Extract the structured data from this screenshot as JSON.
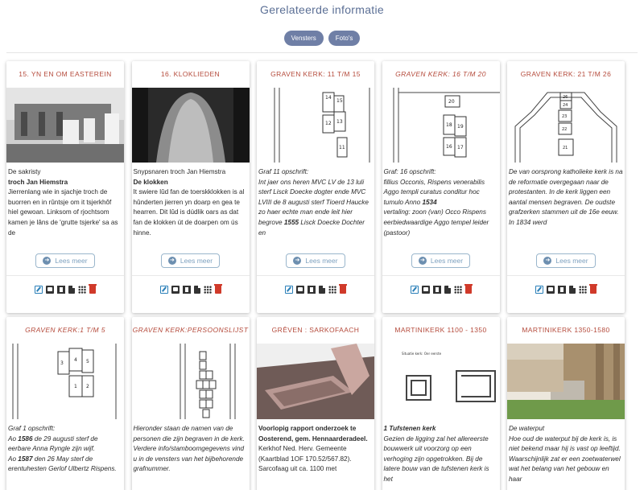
{
  "page": {
    "title": "Gerelateerde informatie",
    "filters": [
      "Vensters",
      "Foto's"
    ]
  },
  "common": {
    "read_more": "Lees meer"
  },
  "cards": [
    {
      "title": "15. YN EN OM EASTEREIN",
      "image_alt": "",
      "text_html": "De sakristy<br><b>troch Jan Hiemstra</b><br>Jierrenlang wie in sjachje troch de buorren en in rûntsje om it tsjerkhôf hiel gewoan. Linksom of rjochtsom kamen je lâns de 'grutte tsjerke' sa as de"
    },
    {
      "title": "16. KLOKLIEDEN",
      "image_alt": "",
      "text_html": "Snypsnaren troch Jan Hiemstra<br><b>De klokken</b><br>It swiere lûd fan de toerskklokken is al hûnderten jierren yn doarp en gea te hearren. Dit lûd is dúdlik oars as dat fan de klokken út de doarpen om ús hinne."
    },
    {
      "title": "GRAVEN KERK: 11 T/M 15",
      "image_alt": "",
      "text_html": "Graf 11 opschrift:<br>Int jaer ons heren MVC LV de 13 luli sterf Lisck Doecke dogter ende MVC LVIII de 8 augusti sterf Tioerd Haucke zo haer echte man ende leit hier begrove <b>1555</b> Lisck Doecke Dochter en"
    },
    {
      "title": "GRAVEN KERK: 16 T/M 20",
      "image_alt": "",
      "text_html": "Graf: 16 opschrift:<br>fillius Occonis, Rispens venerabilis Aggo templi curatus conditur hoc tumulo Anno <b>1534</b><br>vertaling: zoon (van) Occo Rispens eerbiedwaardige Aggo tempel leider (pastoor)"
    },
    {
      "title": "GRAVEN KERK: 21 T/M 26",
      "image_alt": "",
      "text_html": "De van oorsprong katholieke kerk is na de reformatie overgegaan naar de protestanten. In de kerk liggen een aantal mensen begraven. De oudste grafzerken stammen uit de 16e eeuw. In 1834 werd"
    },
    {
      "title": "GRAVEN KERK:1 T/M 5",
      "image_alt": "",
      "text_html": "Graf 1 opschrift:<br>Ao <b>1586</b> de 29 augusti sterf de eerbare Anna Ryngle zijn wijf.<br>Ao <b>1587</b> den 26 May sterf de erentuhesten Gerlof Ulbertz Rispens."
    },
    {
      "title": "GRAVEN KERK:PERSOONSLIJST",
      "image_alt": "",
      "text_html": "Hieronder staan de namen van de personen die zijn begraven in de kerk. Verdere info/stamboomgegevens vind u in de vensters van het bijbehorende grafnummer."
    },
    {
      "title": "GRÊVEN : SARKOFAACH",
      "image_alt": "",
      "text_html": "<b>Voorlopig rapport onderzoek te Oosterend, gem. Hennaarderadeel.</b><br>Kerkhof Ned. Herv. Gemeente (Kaartblad 1OF 170.52/567.82). Sarcofaag uit ca. 1100 met"
    },
    {
      "title": "MARTINIKERK 1100 - 1350",
      "image_alt": "",
      "text_html": "<b>1 Tufstenen kerk</b><br>Gezien de ligging zal het allereerste bouwwerk uit voorzorg op een verhoging zijn opgetrokken. Bij de latere bouw van de tufstenen kerk is het"
    },
    {
      "title": "MARTINIKERK 1350-1580",
      "image_alt": "",
      "text_html": "De waterput<br>Hoe oud de waterput bij de kerk is, is niet bekend maar hij is vast op leeftijd. Waarschijnlijk zat er een zoetwaterwel wat het belang van het gebouw en haar"
    }
  ],
  "diagram_labels": {
    "graves_11_15": [
      "14",
      "15",
      "12",
      "13",
      "11"
    ],
    "graves_16_20": [
      "20",
      "18",
      "19",
      "16",
      "17"
    ],
    "graves_21_26": [
      "26",
      "24",
      "23",
      "22",
      "21"
    ],
    "graves_1_5": [
      "3",
      "4",
      "5",
      "1",
      "2"
    ],
    "martini_drawing_caption": "Situatie kerk: Oer eerste"
  }
}
